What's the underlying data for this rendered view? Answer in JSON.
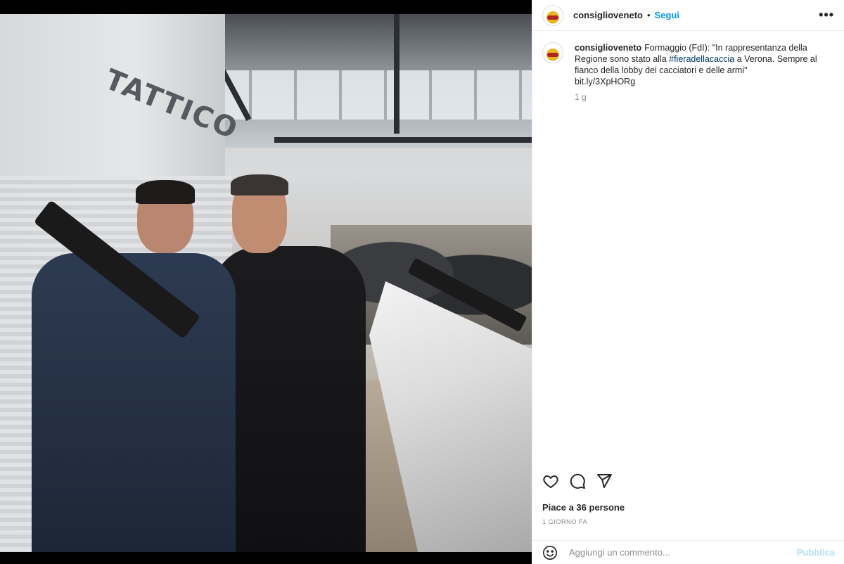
{
  "post": {
    "username": "consiglioveneto",
    "dot": "•",
    "follow_label": "Segui",
    "more_label": "•••",
    "caption_user": "consiglioveneto",
    "caption_text_1": "Formaggio (FdI): \"In rappresentanza della Regione sono stato alla ",
    "caption_hashtag": "#fieradellacaccia",
    "caption_text_2": " a Verona. Sempre al fianco della lobby dei cacciatori e delle armi\"",
    "caption_link": "bit.ly/3XpHORg",
    "caption_time": "1 g",
    "likes_text": "Piace a 36 persone",
    "date_text": "1 GIORNO FA",
    "comment_placeholder": "Aggiungi un commento...",
    "publish_label": "Pubblica"
  },
  "photo": {
    "sign_text": "TATTICO"
  },
  "icons": {
    "like": "heart-icon",
    "comment": "comment-icon",
    "share": "send-icon",
    "emoji": "emoji-icon",
    "more": "more-icon"
  },
  "colors": {
    "accent": "#0095f6",
    "publish_disabled": "#b2dffc",
    "hashtag": "#00376b",
    "muted": "#8e8e8e"
  }
}
